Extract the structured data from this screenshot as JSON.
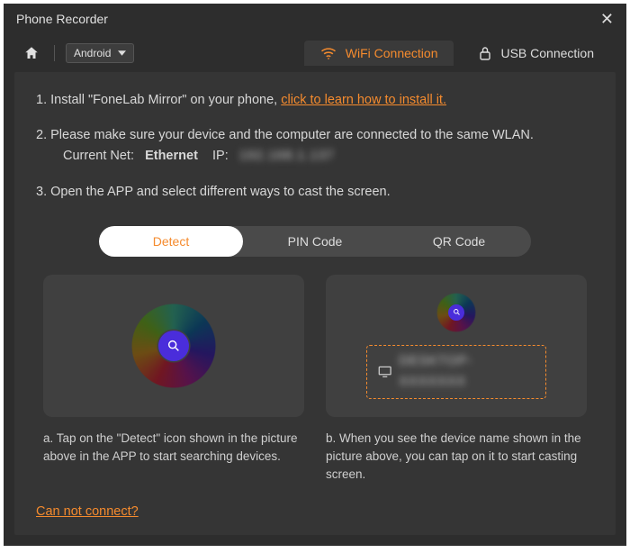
{
  "window": {
    "title": "Phone Recorder"
  },
  "topnav": {
    "os_label": "Android",
    "wifi_tab": "WiFi Connection",
    "usb_tab": "USB Connection"
  },
  "steps": {
    "s1_prefix": "1. Install \"FoneLab Mirror\" on your phone, ",
    "s1_link": "click to learn how to install it.",
    "s2": "2. Please make sure your device and the computer are connected to the same WLAN.",
    "s2_net_label": "Current Net:",
    "s2_net_value": "Ethernet",
    "s2_ip_label": "IP:",
    "s2_ip_value": "192.168.1.137",
    "s3": "3. Open the APP and select different ways to cast the screen."
  },
  "segtabs": {
    "detect": "Detect",
    "pin": "PIN Code",
    "qr": "QR Code"
  },
  "cards": {
    "a_caption": "a. Tap on the \"Detect\" icon shown in the picture above in the APP to start searching devices.",
    "b_caption": "b. When you see the device name shown in the picture above, you can tap on it to start casting screen.",
    "device_placeholder": "DESKTOP-XXXXXXX"
  },
  "footer": {
    "cant_connect": "Can not connect?"
  }
}
